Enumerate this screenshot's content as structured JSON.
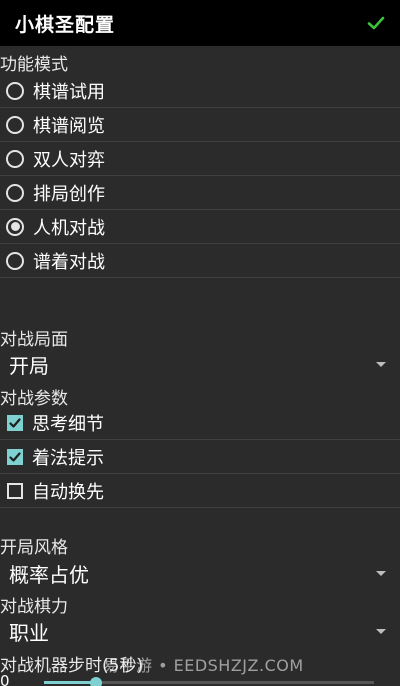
{
  "app": {
    "title": "小棋圣配置",
    "confirm_icon": "check-icon",
    "accent_color": "#7fd1d1",
    "confirm_color": "#3cc23c"
  },
  "mode_section": {
    "label": "功能模式",
    "options": [
      {
        "label": "棋谱试用",
        "selected": false
      },
      {
        "label": "棋谱阅览",
        "selected": false
      },
      {
        "label": "双人对弈",
        "selected": false
      },
      {
        "label": "排局创作",
        "selected": false
      },
      {
        "label": "人机对战",
        "selected": true
      },
      {
        "label": "谱着对战",
        "selected": false
      }
    ]
  },
  "board_section": {
    "label": "对战局面",
    "value": "开局"
  },
  "params_section": {
    "label": "对战参数",
    "options": [
      {
        "label": "思考细节",
        "checked": true
      },
      {
        "label": "着法提示",
        "checked": true
      },
      {
        "label": "自动换先",
        "checked": false
      }
    ]
  },
  "style_section": {
    "label": "开局风格",
    "value": "概率占优"
  },
  "strength_section": {
    "label": "对战棋力",
    "value": "职业"
  },
  "steptime_section": {
    "label": "对战机器步时(5秒)",
    "value": "0"
  },
  "watermark": "易手游 • EEDSHZJZ.COM"
}
